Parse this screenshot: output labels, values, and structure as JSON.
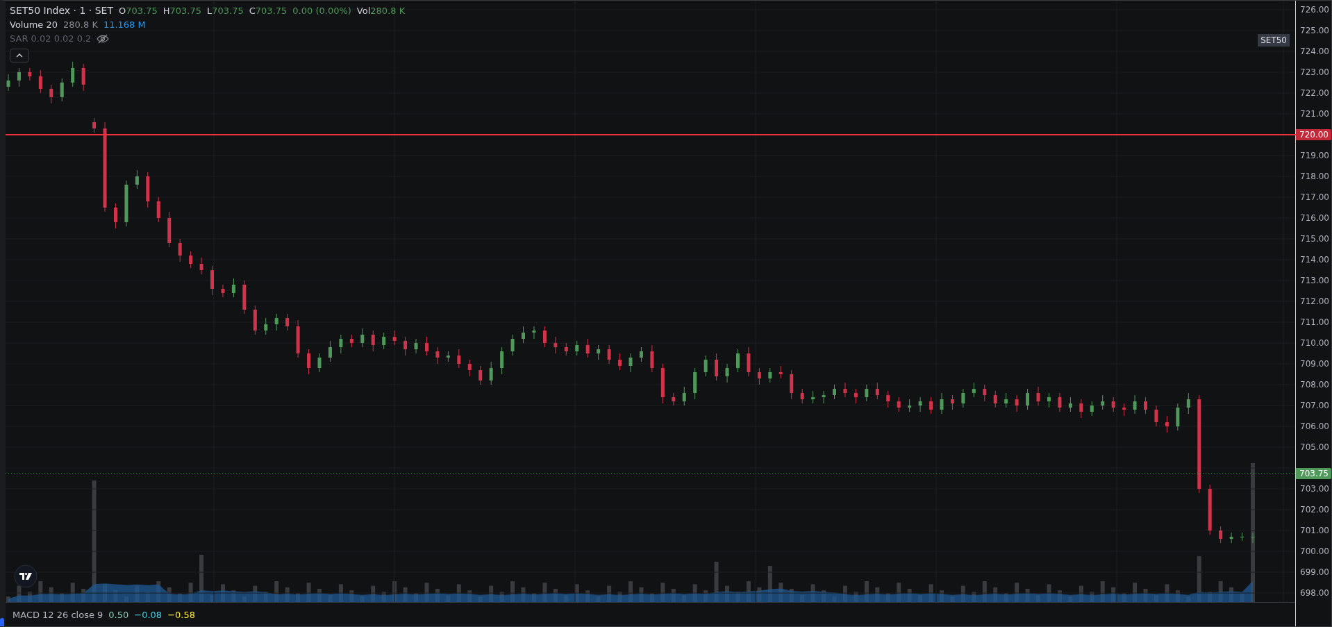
{
  "legend": {
    "symbol": "SET50 Index · 1 · SET",
    "ohlc": [
      {
        "key": "O",
        "value": "703.75"
      },
      {
        "key": "H",
        "value": "703.75"
      },
      {
        "key": "L",
        "value": "703.75"
      },
      {
        "key": "C",
        "value": "703.75"
      }
    ],
    "change": "0.00 (0.00%)",
    "volume_key": "Vol",
    "volume": "280.8 K"
  },
  "indicators": [
    {
      "name": "Volume 20",
      "hidden": false,
      "values": [
        {
          "text": "280.8 K",
          "color": "#8a8c92"
        },
        {
          "text": "11.168 M",
          "color": "#2196f3"
        }
      ]
    },
    {
      "name": "SAR 0.02 0.02 0.2",
      "hidden": true
    }
  ],
  "symbol_badge": "SET50",
  "price_lines": [
    {
      "kind": "alert",
      "label": "720.00"
    },
    {
      "kind": "last_price",
      "label": "703.75"
    }
  ],
  "chart_data": {
    "type": "candlestick",
    "grid": true,
    "ylim": [
      697.57,
      726.43
    ],
    "yticks": [
      {
        "value": 726,
        "label": "726.00"
      },
      {
        "value": 725,
        "label": "725.00"
      },
      {
        "value": 724,
        "label": "724.00"
      },
      {
        "value": 723,
        "label": "723.00"
      },
      {
        "value": 722,
        "label": "722.00"
      },
      {
        "value": 721,
        "label": "721.00"
      },
      {
        "value": 719,
        "label": "719.00"
      },
      {
        "value": 718,
        "label": "718.00"
      },
      {
        "value": 717,
        "label": "717.00"
      },
      {
        "value": 716,
        "label": "716.00"
      },
      {
        "value": 715,
        "label": "715.00"
      },
      {
        "value": 714,
        "label": "714.00"
      },
      {
        "value": 713,
        "label": "713.00"
      },
      {
        "value": 712,
        "label": "712.00"
      },
      {
        "value": 711,
        "label": "711.00"
      },
      {
        "value": 710,
        "label": "710.00"
      },
      {
        "value": 709,
        "label": "709.00"
      },
      {
        "value": 708,
        "label": "708.00"
      },
      {
        "value": 707,
        "label": "707.00"
      },
      {
        "value": 706,
        "label": "706.00"
      },
      {
        "value": 705,
        "label": "705.00"
      },
      {
        "value": 703,
        "label": "703.00"
      },
      {
        "value": 702,
        "label": "702.00"
      },
      {
        "value": 701,
        "label": "701.00"
      },
      {
        "value": 700,
        "label": "700.00"
      },
      {
        "value": 699,
        "label": "699.00"
      },
      {
        "value": 698,
        "label": "698.00"
      }
    ],
    "categories": [
      null,
      null,
      null,
      null,
      null,
      null,
      null,
      null,
      null,
      null,
      null,
      null,
      null,
      null,
      null,
      null,
      null,
      null,
      null,
      null,
      null,
      null,
      null,
      null,
      null,
      null,
      null,
      null,
      null,
      null,
      null,
      null,
      null,
      null,
      null,
      null,
      null,
      null,
      null,
      null,
      null,
      null,
      null,
      null,
      null,
      null,
      null,
      null,
      null,
      null,
      null,
      null,
      null,
      null,
      null,
      null,
      null,
      null,
      null,
      null,
      null,
      null,
      null,
      null,
      null,
      null,
      null,
      null,
      null,
      null,
      null,
      null,
      null,
      null,
      null,
      null,
      null,
      null,
      null,
      null,
      null,
      null,
      null,
      null,
      null,
      null,
      null,
      null,
      null,
      null,
      null,
      null,
      null,
      null,
      null,
      null,
      null,
      null,
      null,
      null,
      null,
      null,
      null,
      null,
      null,
      null,
      null,
      null,
      null,
      null,
      null,
      null,
      null,
      null,
      null,
      null,
      null
    ],
    "ohlc": [
      [
        722.3,
        722.9,
        722.1,
        722.6
      ],
      [
        722.6,
        723.2,
        722.3,
        723.0
      ],
      [
        723.0,
        723.2,
        722.6,
        722.8
      ],
      [
        722.8,
        723.1,
        722.0,
        722.2
      ],
      [
        722.2,
        722.4,
        721.5,
        721.8
      ],
      [
        721.8,
        722.7,
        721.6,
        722.5
      ],
      [
        722.5,
        723.5,
        722.3,
        723.2
      ],
      [
        723.2,
        723.4,
        722.1,
        722.4
      ],
      [
        720.6,
        720.8,
        720.1,
        720.3
      ],
      [
        720.3,
        720.6,
        716.3,
        716.5
      ],
      [
        716.5,
        716.7,
        715.5,
        715.8
      ],
      [
        715.8,
        717.8,
        715.6,
        717.6
      ],
      [
        717.6,
        718.3,
        717.4,
        718.0
      ],
      [
        718.0,
        718.2,
        716.5,
        716.8
      ],
      [
        716.8,
        717.0,
        715.8,
        716.0
      ],
      [
        716.0,
        716.3,
        714.6,
        714.8
      ],
      [
        714.8,
        715.0,
        713.9,
        714.2
      ],
      [
        714.2,
        714.4,
        713.6,
        713.8
      ],
      [
        713.8,
        714.1,
        713.3,
        713.5
      ],
      [
        713.5,
        713.7,
        712.3,
        712.6
      ],
      [
        712.6,
        712.8,
        712.2,
        712.4
      ],
      [
        712.4,
        713.1,
        712.2,
        712.8
      ],
      [
        712.8,
        713.0,
        711.4,
        711.6
      ],
      [
        711.6,
        711.8,
        710.4,
        710.6
      ],
      [
        710.6,
        711.2,
        710.4,
        710.9
      ],
      [
        710.9,
        711.4,
        710.6,
        711.2
      ],
      [
        711.2,
        711.4,
        710.6,
        710.8
      ],
      [
        710.8,
        711.1,
        709.3,
        709.5
      ],
      [
        709.5,
        709.7,
        708.5,
        708.8
      ],
      [
        708.8,
        709.5,
        708.6,
        709.3
      ],
      [
        709.3,
        710.1,
        709.1,
        709.8
      ],
      [
        709.8,
        710.4,
        709.5,
        710.2
      ],
      [
        710.2,
        710.4,
        709.8,
        710.0
      ],
      [
        710.0,
        710.7,
        709.8,
        710.4
      ],
      [
        710.4,
        710.6,
        709.6,
        709.9
      ],
      [
        709.9,
        710.5,
        709.7,
        710.3
      ],
      [
        710.3,
        710.6,
        709.9,
        710.1
      ],
      [
        710.1,
        710.3,
        709.4,
        709.7
      ],
      [
        709.7,
        710.2,
        709.5,
        710.0
      ],
      [
        710.0,
        710.3,
        709.4,
        709.6
      ],
      [
        709.6,
        709.8,
        709.0,
        709.3
      ],
      [
        709.3,
        709.6,
        709.1,
        709.4
      ],
      [
        709.4,
        709.7,
        708.8,
        709.0
      ],
      [
        709.0,
        709.2,
        708.4,
        708.7
      ],
      [
        708.7,
        708.9,
        708.0,
        708.2
      ],
      [
        708.2,
        709.1,
        708.0,
        708.8
      ],
      [
        708.8,
        709.8,
        708.5,
        709.6
      ],
      [
        709.6,
        710.4,
        709.4,
        710.2
      ],
      [
        710.2,
        710.8,
        710.0,
        710.5
      ],
      [
        710.5,
        710.8,
        710.2,
        710.6
      ],
      [
        710.6,
        710.8,
        709.8,
        710.0
      ],
      [
        710.0,
        710.3,
        709.5,
        709.8
      ],
      [
        709.8,
        710.0,
        709.4,
        709.6
      ],
      [
        709.6,
        710.1,
        709.4,
        709.9
      ],
      [
        709.9,
        710.2,
        709.3,
        709.5
      ],
      [
        709.5,
        709.9,
        709.2,
        709.7
      ],
      [
        709.7,
        709.9,
        709.0,
        709.2
      ],
      [
        709.2,
        709.5,
        708.7,
        708.9
      ],
      [
        708.9,
        709.5,
        708.6,
        709.3
      ],
      [
        709.3,
        709.8,
        709.1,
        709.6
      ],
      [
        709.6,
        709.9,
        708.6,
        708.8
      ],
      [
        708.8,
        709.0,
        707.1,
        707.4
      ],
      [
        707.4,
        707.6,
        707.0,
        707.2
      ],
      [
        707.2,
        707.9,
        707.0,
        707.6
      ],
      [
        707.6,
        708.8,
        707.3,
        708.6
      ],
      [
        708.6,
        709.4,
        708.4,
        709.2
      ],
      [
        709.2,
        709.5,
        708.2,
        708.4
      ],
      [
        708.4,
        709.0,
        708.1,
        708.8
      ],
      [
        708.8,
        709.7,
        708.6,
        709.5
      ],
      [
        709.5,
        709.8,
        708.4,
        708.6
      ],
      [
        708.6,
        708.8,
        708.0,
        708.3
      ],
      [
        708.3,
        708.8,
        708.1,
        708.6
      ],
      [
        708.6,
        708.9,
        708.3,
        708.5
      ],
      [
        708.5,
        708.7,
        707.3,
        707.6
      ],
      [
        707.6,
        707.8,
        707.1,
        707.3
      ],
      [
        707.3,
        707.7,
        707.1,
        707.4
      ],
      [
        707.4,
        707.7,
        707.1,
        707.5
      ],
      [
        707.5,
        708.0,
        707.3,
        707.8
      ],
      [
        707.8,
        708.1,
        707.4,
        707.6
      ],
      [
        707.6,
        707.8,
        707.1,
        707.4
      ],
      [
        707.4,
        708.0,
        707.2,
        707.8
      ],
      [
        707.8,
        708.1,
        707.3,
        707.5
      ],
      [
        707.5,
        707.7,
        706.9,
        707.2
      ],
      [
        707.2,
        707.4,
        706.7,
        706.9
      ],
      [
        706.9,
        707.3,
        706.7,
        707.0
      ],
      [
        707.0,
        707.4,
        706.7,
        707.2
      ],
      [
        707.2,
        707.4,
        706.6,
        706.8
      ],
      [
        706.8,
        707.6,
        706.6,
        707.3
      ],
      [
        707.3,
        707.5,
        706.8,
        707.1
      ],
      [
        707.1,
        707.8,
        706.9,
        707.6
      ],
      [
        707.6,
        708.1,
        707.4,
        707.8
      ],
      [
        707.8,
        708.0,
        707.2,
        707.5
      ],
      [
        707.5,
        707.7,
        706.9,
        707.1
      ],
      [
        707.1,
        707.6,
        706.9,
        707.3
      ],
      [
        707.3,
        707.5,
        706.7,
        707.0
      ],
      [
        707.0,
        707.8,
        706.8,
        707.6
      ],
      [
        707.6,
        707.9,
        707.0,
        707.2
      ],
      [
        707.2,
        707.6,
        706.9,
        707.4
      ],
      [
        707.4,
        707.6,
        706.7,
        706.9
      ],
      [
        706.9,
        707.4,
        706.7,
        707.1
      ],
      [
        707.1,
        707.3,
        706.4,
        706.7
      ],
      [
        706.7,
        707.2,
        706.5,
        707.0
      ],
      [
        707.0,
        707.5,
        706.8,
        707.2
      ],
      [
        707.2,
        707.4,
        706.7,
        706.9
      ],
      [
        706.9,
        707.1,
        706.5,
        706.8
      ],
      [
        706.8,
        707.5,
        706.6,
        707.2
      ],
      [
        707.2,
        707.4,
        706.6,
        706.8
      ],
      [
        706.8,
        707.0,
        706.0,
        706.2
      ],
      [
        706.2,
        706.5,
        705.7,
        706.0
      ],
      [
        706.0,
        707.1,
        705.8,
        706.9
      ],
      [
        706.9,
        707.6,
        706.6,
        707.3
      ],
      [
        707.3,
        707.5,
        702.8,
        703.0
      ],
      [
        703.0,
        703.2,
        700.8,
        701.0
      ],
      [
        701.0,
        701.2,
        700.4,
        700.6
      ],
      [
        700.6,
        700.9,
        700.4,
        700.7
      ],
      [
        700.7,
        700.9,
        700.5,
        700.7
      ],
      [
        700.7,
        700.9,
        700.4,
        700.7
      ]
    ]
  },
  "macd": {
    "name": "MACD 12 26 close 9",
    "values": [
      {
        "text": "0.50",
        "color": "#8fcdb8"
      },
      {
        "text": "−0.08",
        "color": "#4dd0e1"
      },
      {
        "text": "−0.58",
        "color": "#ffeb3b"
      }
    ]
  }
}
